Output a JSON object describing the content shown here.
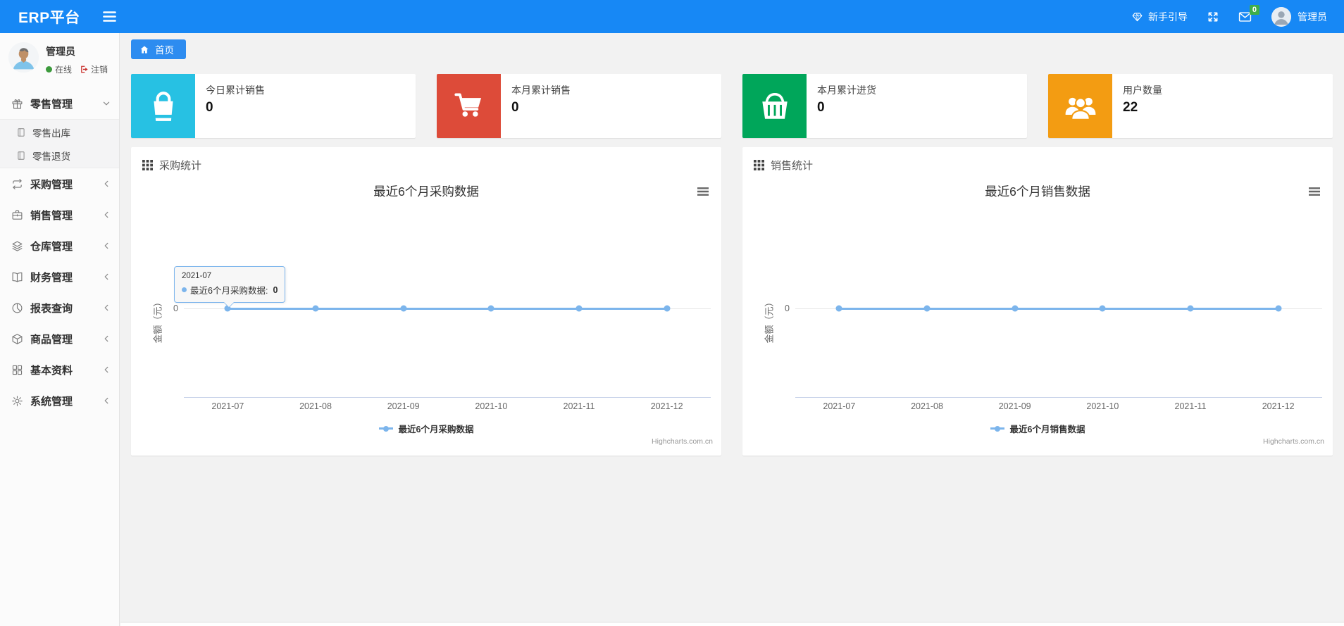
{
  "navbar": {
    "brand": "ERP平台",
    "guide": "新手引导",
    "mail_badge": "0",
    "user": "管理员"
  },
  "breadcrumb": {
    "home": "首页"
  },
  "sidebar": {
    "user": {
      "name": "管理员",
      "status": "在线",
      "logout": "注销"
    },
    "menu": [
      {
        "key": "retail",
        "label": "零售管理",
        "icon": "gift-icon",
        "state": "expanded",
        "children": [
          {
            "key": "retail-outbound",
            "label": "零售出库",
            "icon": "journal-icon"
          },
          {
            "key": "retail-return",
            "label": "零售退货",
            "icon": "journal-icon"
          }
        ]
      },
      {
        "key": "purchase",
        "label": "采购管理",
        "icon": "repeat-icon",
        "state": "collapsed"
      },
      {
        "key": "sales",
        "label": "销售管理",
        "icon": "briefcase-icon",
        "state": "collapsed"
      },
      {
        "key": "warehouse",
        "label": "仓库管理",
        "icon": "layers-icon",
        "state": "collapsed"
      },
      {
        "key": "finance",
        "label": "财务管理",
        "icon": "book-icon",
        "state": "collapsed"
      },
      {
        "key": "reports",
        "label": "报表查询",
        "icon": "pie-icon",
        "state": "collapsed"
      },
      {
        "key": "goods",
        "label": "商品管理",
        "icon": "box-icon",
        "state": "collapsed"
      },
      {
        "key": "basic-data",
        "label": "基本资料",
        "icon": "grid-icon",
        "state": "collapsed"
      },
      {
        "key": "system",
        "label": "系统管理",
        "icon": "gear-icon",
        "state": "collapsed"
      }
    ]
  },
  "stat_cards": [
    {
      "key": "today-sales",
      "label": "今日累计销售",
      "value": "0",
      "icon": "shopping-bag-icon",
      "color": "#27c1e3"
    },
    {
      "key": "month-sales",
      "label": "本月累计销售",
      "value": "0",
      "icon": "cart-icon",
      "color": "#dd4b39"
    },
    {
      "key": "month-purchase",
      "label": "本月累计进货",
      "value": "0",
      "icon": "basket-icon",
      "color": "#00a65a"
    },
    {
      "key": "user-count",
      "label": "用户数量",
      "value": "22",
      "icon": "users-icon",
      "color": "#f39c12"
    }
  ],
  "panels": [
    {
      "key": "purchase-stats",
      "title": "采购统计"
    },
    {
      "key": "sales-stats",
      "title": "销售统计"
    }
  ],
  "chart_data": [
    {
      "type": "line",
      "title": "最近6个月采购数据",
      "categories": [
        "2021-07",
        "2021-08",
        "2021-09",
        "2021-10",
        "2021-11",
        "2021-12"
      ],
      "series": [
        {
          "name": "最近6个月采购数据",
          "values": [
            0,
            0,
            0,
            0,
            0,
            0
          ]
        }
      ],
      "xlabel": "",
      "ylabel": "金额（元）",
      "yticks": [
        "0"
      ],
      "series_color": "#7cb5ec",
      "grid": true,
      "legend_position": "bottom",
      "credits": "Highcharts.com.cn",
      "tooltip": {
        "header": "2021-07",
        "label": "最近6个月采购数据",
        "value": "0"
      }
    },
    {
      "type": "line",
      "title": "最近6个月销售数据",
      "categories": [
        "2021-07",
        "2021-08",
        "2021-09",
        "2021-10",
        "2021-11",
        "2021-12"
      ],
      "series": [
        {
          "name": "最近6个月销售数据",
          "values": [
            0,
            0,
            0,
            0,
            0,
            0
          ]
        }
      ],
      "xlabel": "",
      "ylabel": "金额（元）",
      "yticks": [
        "0"
      ],
      "series_color": "#7cb5ec",
      "grid": true,
      "legend_position": "bottom",
      "credits": "Highcharts.com.cn"
    }
  ]
}
